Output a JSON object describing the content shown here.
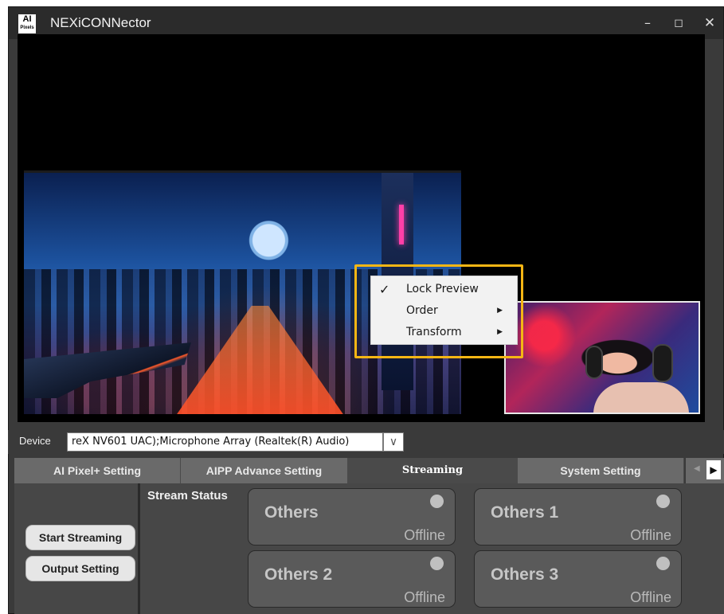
{
  "window": {
    "logo_top": "AI",
    "logo_bottom": "Pixels",
    "title": "NEXiCONNector",
    "minimize": "–",
    "maximize": "◻",
    "close": "✕"
  },
  "context_menu": {
    "items": [
      {
        "label": "Lock Preview",
        "checked": true,
        "check": "✓",
        "submenu": false
      },
      {
        "label": "Order",
        "checked": false,
        "check": "",
        "submenu": true,
        "arrow": "▶"
      },
      {
        "label": "Transform",
        "checked": false,
        "check": "",
        "submenu": true,
        "arrow": "▶"
      }
    ]
  },
  "device": {
    "label": "Device",
    "value": "reX NV601 UAC);Microphone Array (Realtek(R) Audio)",
    "dropdown": "∨"
  },
  "tabs": [
    {
      "label": "AI Pixel+ Setting"
    },
    {
      "label": "AIPP Advance Setting"
    },
    {
      "label": "Streaming"
    },
    {
      "label": "System Setting"
    }
  ],
  "tab_scroll": {
    "left": "◀",
    "right": "▶"
  },
  "streaming": {
    "start_button": "Start Streaming",
    "output_button": "Output Setting",
    "status_label": "Stream Status",
    "cards": [
      {
        "name": "Others",
        "status": "Offline"
      },
      {
        "name": "Others 1",
        "status": "Offline"
      },
      {
        "name": "Others 2",
        "status": "Offline"
      },
      {
        "name": "Others 3",
        "status": "Offline"
      }
    ]
  },
  "colors": {
    "highlight": "#f5b614",
    "background": "#3a3a3a",
    "active_tab": "#4a4a4a"
  }
}
